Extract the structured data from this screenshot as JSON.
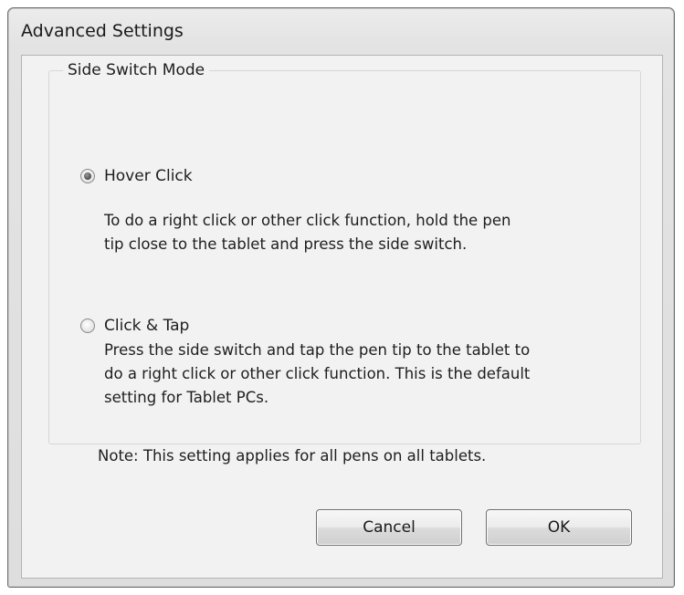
{
  "window": {
    "title": "Advanced Settings"
  },
  "group": {
    "label": "Side Switch Mode",
    "options": [
      {
        "label": "Hover Click",
        "selected": true,
        "description": "To do a right click or other click function, hold the pen\ntip close to the tablet and press the side switch."
      },
      {
        "label": "Click & Tap",
        "selected": false,
        "description": "Press the side switch and tap the pen tip to the tablet to\ndo a right click or other click function. This is the default\nsetting for Tablet PCs."
      }
    ],
    "note": "Note: This setting applies for all pens on all tablets."
  },
  "buttons": {
    "cancel": "Cancel",
    "ok": "OK"
  }
}
